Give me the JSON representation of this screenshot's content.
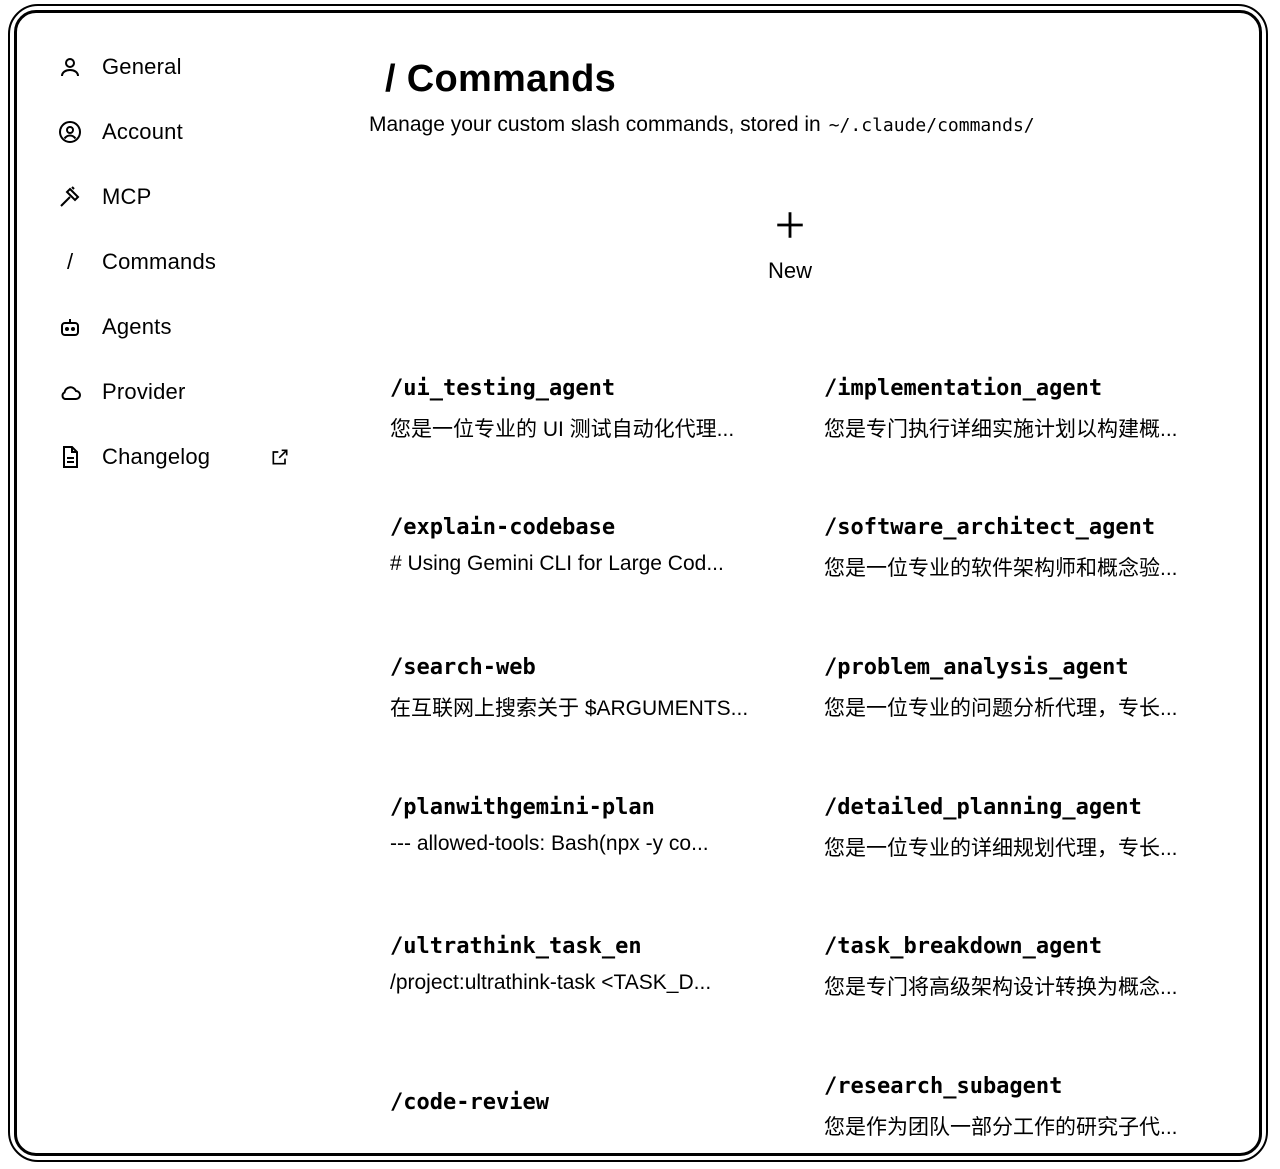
{
  "sidebar": {
    "items": [
      {
        "label": "General",
        "icon": "user-icon"
      },
      {
        "label": "Account",
        "icon": "account-circle-icon"
      },
      {
        "label": "MCP",
        "icon": "hammer-icon"
      },
      {
        "label": "Commands",
        "icon": "slash-icon"
      },
      {
        "label": "Agents",
        "icon": "robot-icon"
      },
      {
        "label": "Provider",
        "icon": "cloud-icon"
      },
      {
        "label": "Changelog",
        "icon": "document-icon",
        "external": "external-link-icon"
      }
    ],
    "slash_glyph": "/"
  },
  "header": {
    "title": "/ Commands",
    "subtitle": "Manage your custom slash commands, stored in",
    "path": "~/.claude/commands/"
  },
  "new_button": {
    "label": "New"
  },
  "commands": [
    {
      "name": "/ui_testing_agent",
      "desc": "您是一位专业的 UI 测试自动化代理..."
    },
    {
      "name": "/implementation_agent",
      "desc": "您是专门执行详细实施计划以构建概..."
    },
    {
      "name": "/explain-codebase",
      "desc": "# Using Gemini CLI for Large Cod..."
    },
    {
      "name": "/software_architect_agent",
      "desc": "您是一位专业的软件架构师和概念验..."
    },
    {
      "name": "/search-web",
      "desc": "在互联网上搜索关于 $ARGUMENTS..."
    },
    {
      "name": "/problem_analysis_agent",
      "desc": "您是一位专业的问题分析代理，专长..."
    },
    {
      "name": "/planwithgemini-plan",
      "desc": "--- allowed-tools: Bash(npx -y co..."
    },
    {
      "name": "/detailed_planning_agent",
      "desc": "您是一位专业的详细规划代理，专长..."
    },
    {
      "name": "/ultrathink_task_en",
      "desc": "/project:ultrathink-task <TASK_D..."
    },
    {
      "name": "/task_breakdown_agent",
      "desc": "您是专门将高级架构设计转换为概念..."
    },
    {
      "name": "/code-review",
      "desc": ""
    },
    {
      "name": "/research_subagent",
      "desc": "您是作为团队一部分工作的研究子代..."
    }
  ]
}
